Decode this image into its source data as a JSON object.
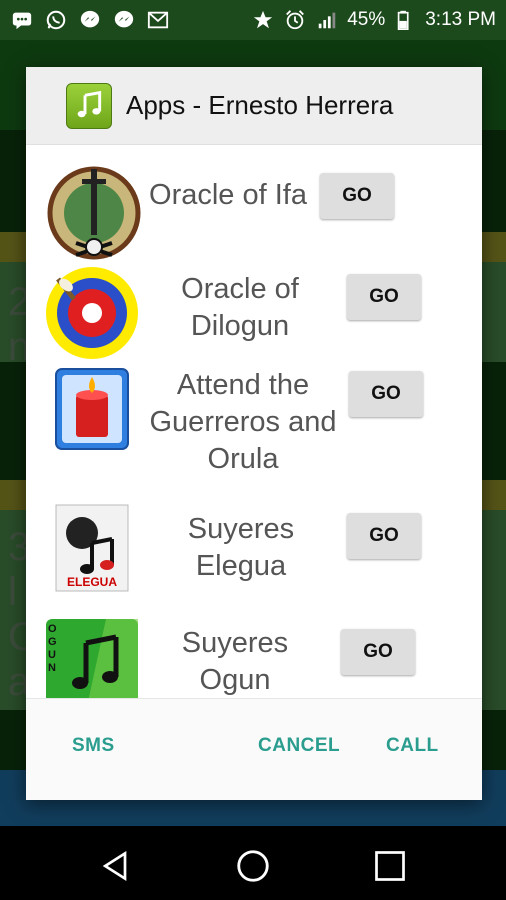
{
  "status_bar": {
    "battery": "45%",
    "time": "3:13 PM",
    "left_icons": [
      "message-icon",
      "whatsapp-icon",
      "messenger-icon",
      "messenger-icon",
      "gmail-icon"
    ],
    "right_icons": [
      "star-icon",
      "alarm-icon",
      "signal-icon",
      "battery-icon"
    ]
  },
  "background": {
    "fragments": [
      "2",
      "n",
      "3",
      "l",
      "C",
      "a"
    ]
  },
  "dialog": {
    "title": "Apps - Ernesto Herrera",
    "items": [
      {
        "label_lines": [
          "Oracle of Ifa"
        ],
        "button": "GO",
        "icon": "ifa-oracle-icon"
      },
      {
        "label_lines": [
          "Oracle of",
          "Dilogun"
        ],
        "button": "GO",
        "icon": "dilogun-target-icon"
      },
      {
        "label_lines": [
          "Attend the",
          "Guerreros and",
          "Orula"
        ],
        "button": "GO",
        "icon": "candle-icon"
      },
      {
        "label_lines": [
          "Suyeres",
          "Elegua"
        ],
        "button": "GO",
        "icon": "elegua-music-icon",
        "icon_text": "ELEGUA"
      },
      {
        "label_lines": [
          "Suyeres",
          "Ogun"
        ],
        "button": "GO",
        "icon": "ogun-music-icon",
        "icon_text": "OGUN"
      }
    ],
    "footer": {
      "sms": "SMS",
      "cancel": "CANCEL",
      "call": "CALL"
    }
  },
  "colors": {
    "accent": "#2a9d8f",
    "app_bg": "#0f3f12",
    "band": "#9c9a2a"
  }
}
